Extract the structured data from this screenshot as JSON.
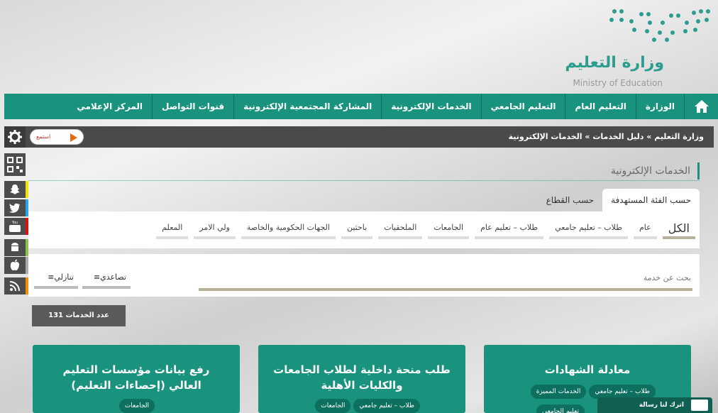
{
  "header": {
    "logo_ar": "وزارة التعليم",
    "logo_en": "Ministry of Education"
  },
  "nav": {
    "home_icon": "home-icon",
    "items": [
      "الوزارة",
      "التعليم العام",
      "التعليم الجامعي",
      "الخدمات الإلكترونية",
      "المشاركة المجتمعية الإلكترونية",
      "قنوات التواصل",
      "المركز الإعلامي"
    ]
  },
  "breadcrumb": "وزارة التعليم » دليل الخدمات » الخدمات الإلكترونية",
  "listen_label": "استمع",
  "section_title": "الخدمات الإلكترونية",
  "tabs": [
    "حسب الفئة المستهدفة",
    "حسب القطاع"
  ],
  "filters": [
    "الكل",
    "عام",
    "طلاب – تعليم جامعي",
    "طلاب – تعليم عام",
    "الجامعات",
    "الملحقيات",
    "باحثين",
    "الجهات الحكومية والخاصة",
    "ولي الامر",
    "المعلم"
  ],
  "search": {
    "placeholder": "بحث عن خدمة"
  },
  "sort": {
    "asc": "تصاعدي",
    "desc": "تنازلي"
  },
  "count": "عدد الخدمات 131",
  "cards": [
    {
      "title": "معادلة الشهادات",
      "tags": [
        "طلاب – تعليم جامعي",
        "الخدمات المميزة",
        "تعليم الجامعي"
      ]
    },
    {
      "title": "طلب منحة داخلية لطلاب الجامعات والكليات الأهلية",
      "tags": [
        "طلاب – تعليم جامعي",
        "الجامعات"
      ]
    },
    {
      "title": "رفع بيانات مؤسسات التعليم العالي (إحصاءات التعليم)",
      "tags": [
        "الجامعات"
      ]
    }
  ],
  "message_button": "اترك لنا رسالة",
  "colors": {
    "primary": "#19937e",
    "dark": "#4a4a4a",
    "accent": "#b9b19b"
  }
}
